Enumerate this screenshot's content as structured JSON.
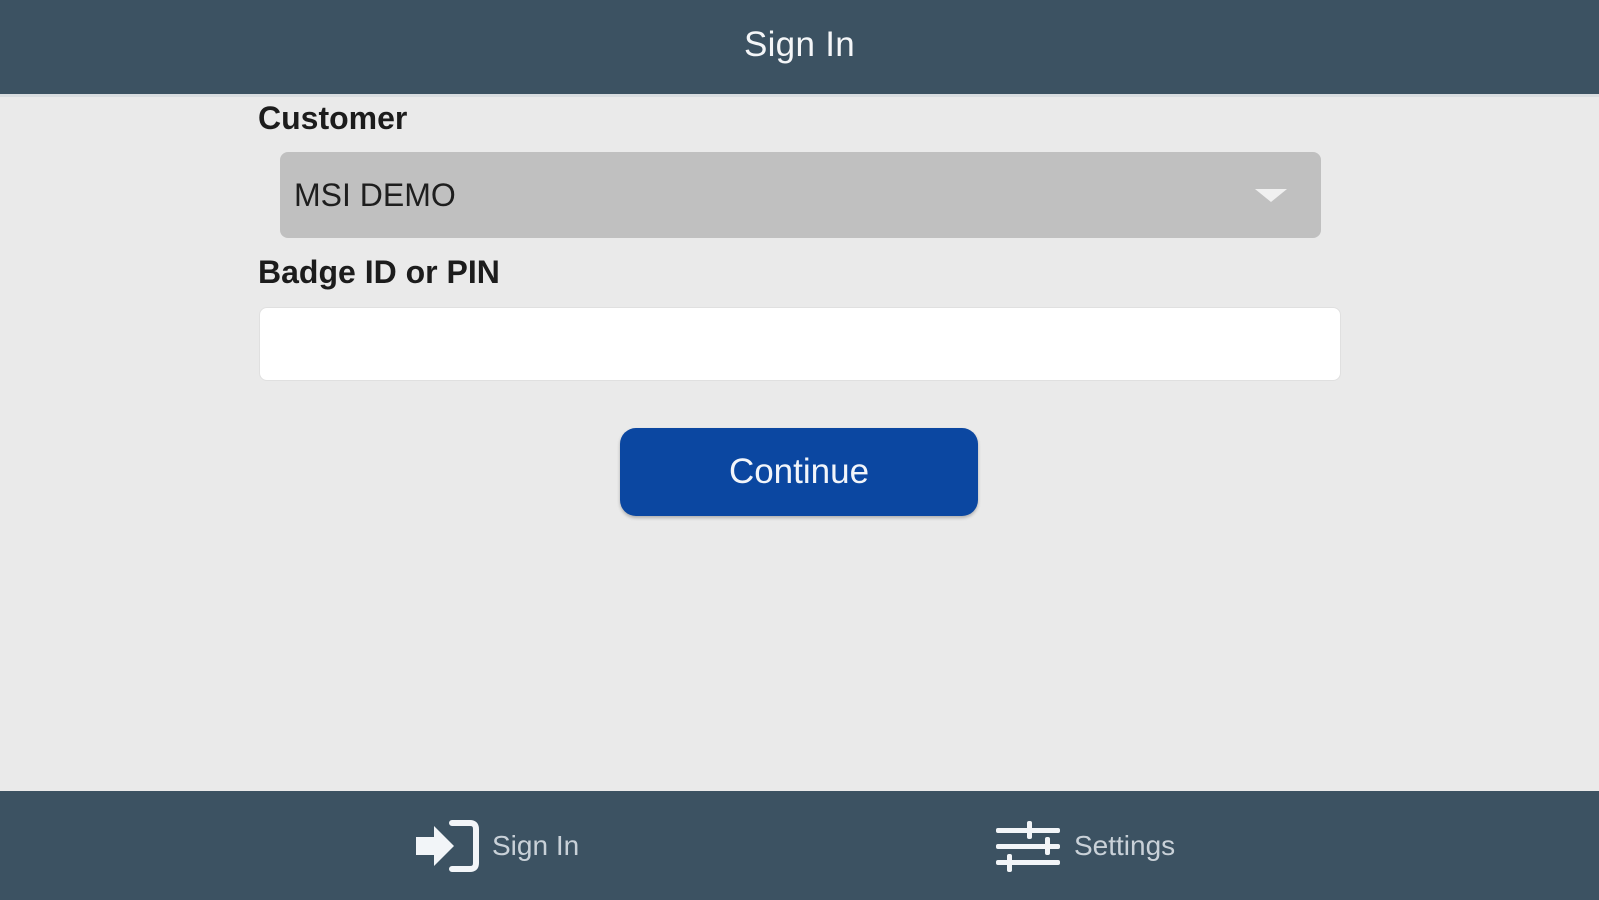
{
  "header": {
    "title": "Sign In"
  },
  "form": {
    "customer_label": "Customer",
    "customer_value": "MSI DEMO",
    "badge_label": "Badge ID or PIN",
    "badge_value": "",
    "badge_placeholder": "",
    "continue_label": "Continue"
  },
  "tab_bar": {
    "items": [
      {
        "label": "Sign In",
        "icon": "sign-in-icon"
      },
      {
        "label": "Settings",
        "icon": "sliders-icon"
      }
    ]
  },
  "colors": {
    "header_bg": "#3c5262",
    "page_bg": "#eaeaea",
    "primary_button": "#0b47a1",
    "select_bg": "#c0c0c0"
  }
}
